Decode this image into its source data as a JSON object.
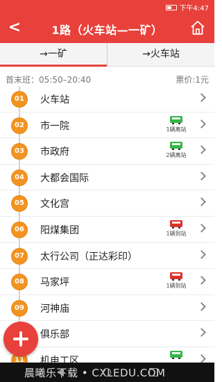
{
  "statusbar": {
    "time": "下午4:47"
  },
  "header": {
    "back_label": "<",
    "title": "1路（火车站—一矿）"
  },
  "tabs": [
    {
      "label": "→一矿",
      "active": true
    },
    {
      "label": "→火车站",
      "active": false
    }
  ],
  "info": {
    "schedule": "首末班：05:50–20:40",
    "price": "票价:1元"
  },
  "stations": [
    {
      "no": "01",
      "name": "火车站",
      "bus": null
    },
    {
      "no": "02",
      "name": "市一院",
      "bus": {
        "color": "green",
        "text": "1辆离站"
      }
    },
    {
      "no": "03",
      "name": "市政府",
      "bus": {
        "color": "green",
        "text": "2辆离站"
      }
    },
    {
      "no": "04",
      "name": "大都会国际",
      "bus": null
    },
    {
      "no": "05",
      "name": "文化宫",
      "bus": null
    },
    {
      "no": "06",
      "name": "阳煤集团",
      "bus": {
        "color": "red",
        "text": "1辆到站"
      }
    },
    {
      "no": "07",
      "name": "太行公司（正达彩印）",
      "bus": null
    },
    {
      "no": "08",
      "name": "马家坪",
      "bus": {
        "color": "red",
        "text": "1辆到站"
      }
    },
    {
      "no": "09",
      "name": "河神庙",
      "bus": null
    },
    {
      "no": "10",
      "name": "俱乐部",
      "bus": null
    },
    {
      "no": "11",
      "name": "机电工区",
      "bus": {
        "color": "green",
        "text": ""
      }
    }
  ],
  "watermark": "晨曦乐下载 • CXLEDU.COM",
  "colors": {
    "accent": "#e8403a",
    "badge": "#f29322",
    "bus_green": "#39b54a",
    "bus_red": "#d9342b"
  }
}
